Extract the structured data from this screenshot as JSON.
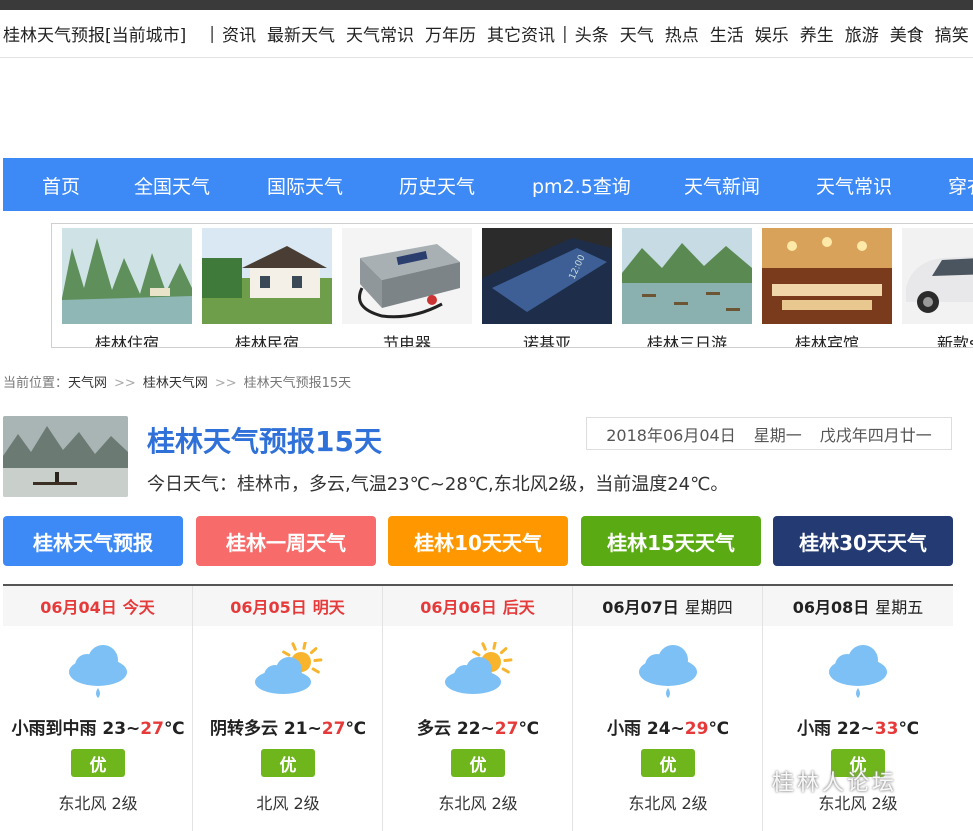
{
  "topnav": {
    "site": "桂林天气预报[当前城市]",
    "sep1": "|",
    "group1": [
      "资讯",
      "最新天气",
      "天气常识",
      "万年历",
      "其它资讯"
    ],
    "sep2": "|",
    "group2": [
      "头条",
      "天气",
      "热点",
      "生活",
      "娱乐",
      "养生",
      "旅游",
      "美食",
      "搞笑"
    ]
  },
  "mainnav": [
    "首页",
    "全国天气",
    "国际天气",
    "历史天气",
    "pm2.5查询",
    "天气新闻",
    "天气常识",
    "穿衣"
  ],
  "ads": [
    "桂林住宿",
    "桂林民宿",
    "节电器",
    "诺基亚",
    "桂林三日游",
    "桂林宾馆",
    "新款suv"
  ],
  "crumb": {
    "prefix": "当前位置：",
    "items": [
      "天气网",
      "桂林天气网",
      "桂林天气预报15天"
    ],
    "sep": ">>"
  },
  "header": {
    "title": "桂林天气预报15天",
    "date": "2018年06月04日",
    "weekday": "星期一",
    "lunar": "戊戌年四月廿一",
    "today": "今日天气：桂林市，多云,气温23℃~28℃,东北风2级，当前温度24℃。"
  },
  "tabs": [
    {
      "label": "桂林天气预报",
      "color": "#3d8af7"
    },
    {
      "label": "桂林一周天气",
      "color": "#f76b6b"
    },
    {
      "label": "桂林10天天气",
      "color": "#ff9800"
    },
    {
      "label": "桂林15天天气",
      "color": "#5aaa14"
    },
    {
      "label": "桂林30天天气",
      "color": "#233a73"
    }
  ],
  "forecast": [
    {
      "date": "06月04日",
      "week": "今天",
      "highlight": true,
      "icon": "rain-cloud-icon",
      "cond": "小雨到中雨 23~",
      "hi": "27",
      "unit": "℃",
      "aqi": "优",
      "wind": "东北风 2级"
    },
    {
      "date": "06月05日",
      "week": "明天",
      "highlight": true,
      "icon": "partly-cloudy-icon",
      "cond": "阴转多云 21~",
      "hi": "27",
      "unit": "℃",
      "aqi": "优",
      "wind": "北风 2级"
    },
    {
      "date": "06月06日",
      "week": "后天",
      "highlight": true,
      "icon": "partly-cloudy-icon",
      "cond": "多云 22~",
      "hi": "27",
      "unit": "℃",
      "aqi": "优",
      "wind": "东北风 2级"
    },
    {
      "date": "06月07日",
      "week": "星期四",
      "highlight": false,
      "icon": "rain-cloud-icon",
      "cond": "小雨 24~",
      "hi": "29",
      "unit": "℃",
      "aqi": "优",
      "wind": "东北风 2级"
    },
    {
      "date": "06月08日",
      "week": "星期五",
      "highlight": false,
      "icon": "rain-cloud-icon",
      "cond": "小雨 22~",
      "hi": "33",
      "unit": "℃",
      "aqi": "优",
      "wind": "东北风 2级"
    }
  ],
  "watermark": "桂林人论坛",
  "colors": {
    "nav": "#3d8af7",
    "title": "#2f71d8",
    "hot": "#e63a3a",
    "aqi": "#6fb51c",
    "cloud": "#7cc0f5",
    "sun": "#f7b42c"
  }
}
